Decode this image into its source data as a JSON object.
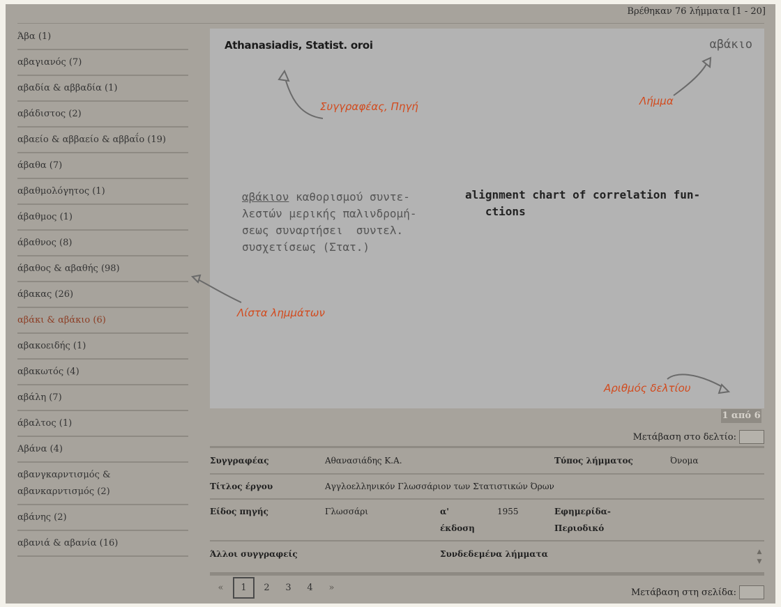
{
  "header": {
    "found_text": "Βρέθηκαν 76 λήμματα [1 - 20]"
  },
  "sidebar": {
    "items": [
      {
        "label": "Άβα (1)"
      },
      {
        "label": "αβαγιανός (7)"
      },
      {
        "label": "αβαδία & αββαδία (1)"
      },
      {
        "label": "αβάδιστος (2)"
      },
      {
        "label": "αβαείο & αββαείο & αββαΐο (19)"
      },
      {
        "label": "άβαθα (7)"
      },
      {
        "label": "αβαθμολόγητος (1)"
      },
      {
        "label": "άβαθμος (1)"
      },
      {
        "label": "άβαθνος (8)"
      },
      {
        "label": "άβαθος & αβαθής (98)"
      },
      {
        "label": "άβακας (26)"
      },
      {
        "label": "αβάκι & αβάκιο (6)"
      },
      {
        "label": "αβακοειδής (1)"
      },
      {
        "label": "αβακωτός (4)"
      },
      {
        "label": "αβάλη (7)"
      },
      {
        "label": "άβαλτος (1)"
      },
      {
        "label": "Αβάνα (4)"
      },
      {
        "label": "αβανγκαρντισμός & αβανκαρντισμός (2)"
      },
      {
        "label": "αβάνης (2)"
      },
      {
        "label": "αβανιά & αβανία (16)"
      }
    ]
  },
  "card": {
    "source_text": "Athanasiadis, Statist. oroi",
    "lemma_text": "αβάκιο",
    "greek_lines": [
      "αβάκιον",
      " καθορισμού συντε-",
      "λεστών μερικής παλινδρομή-",
      "σεως συναρτήσει  συντελ.",
      "συσχετίσεως (Στατ.)"
    ],
    "english_lines": [
      "alignment chart of correlation fun-",
      "   ctions"
    ],
    "annotations": {
      "author": "Συγγραφέας, Πηγή",
      "lemma": "Λήμμα",
      "list": "Λίστα λημμάτων",
      "card_number": "Αριθμός δελτίου"
    },
    "page_badge": "1 από 6",
    "goto_label": "Μετάβαση στο δελτίο:"
  },
  "meta": {
    "author_label": "Συγγραφέας",
    "author_value": "Αθανασιάδης Κ.Α.",
    "type_label": "Τύπος λήμματος",
    "type_value": "Όνομα",
    "title_label": "Τίτλος έργου",
    "title_value": "Αγγλοελληνικόν Γλωσσάριον των Στατιστικών Όρων",
    "source_kind_label": "Είδος πηγής",
    "source_kind_value": "Γλωσσάρι",
    "edition_label_1": "α'",
    "edition_label_2": "έκδοση",
    "edition_value": "1955",
    "journal_label_1": "Εφημερίδα-",
    "journal_label_2": "Περιοδικό",
    "other_authors_label": "Άλλοι συγγραφείς",
    "linked_label": "Συνδεδεμένα λήμματα"
  },
  "pager": {
    "prev": "«",
    "pages": [
      "1",
      "2",
      "3",
      "4"
    ],
    "current": "1",
    "next": "»",
    "goto_label": "Μετάβαση στη σελίδα:"
  }
}
